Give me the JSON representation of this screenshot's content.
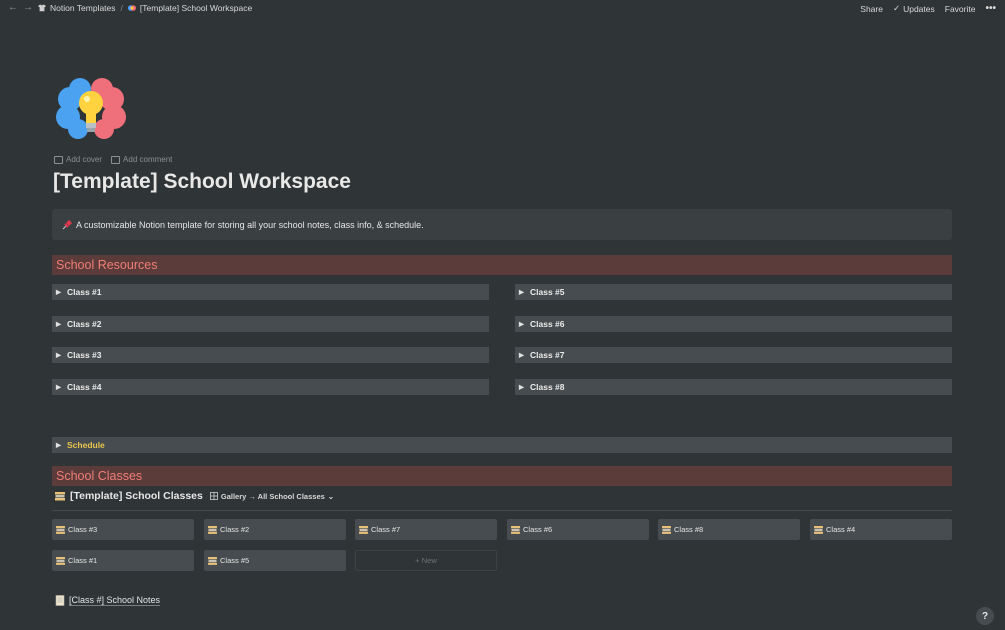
{
  "topbar": {
    "breadcrumb_root": "Notion Templates",
    "breadcrumb_separator": "/",
    "breadcrumb_page": "[Template] School Workspace",
    "share_label": "Share",
    "updates_label": "Updates",
    "favorite_label": "Favorite",
    "more_label": "•••"
  },
  "page": {
    "icon": "brain-lightbulb-icon",
    "add_cover_label": "Add cover",
    "add_comment_label": "Add comment",
    "title": "[Template] School Workspace",
    "callout_icon": "pushpin-icon",
    "callout_text": "A customizable Notion template for storing all your school notes, class info, & schedule."
  },
  "resources": {
    "heading": "School Resources",
    "toggles_left": [
      {
        "label": "Class #1"
      },
      {
        "label": "Class #2"
      },
      {
        "label": "Class #3"
      },
      {
        "label": "Class #4"
      }
    ],
    "toggles_right": [
      {
        "label": "Class #5"
      },
      {
        "label": "Class #6"
      },
      {
        "label": "Class #7"
      },
      {
        "label": "Class #8"
      }
    ],
    "schedule_label": "Schedule"
  },
  "classes": {
    "heading": "School Classes",
    "db_title": "[Template] School Classes",
    "view_label": "Gallery → All School Classes",
    "cards": [
      {
        "label": "Class #3"
      },
      {
        "label": "Class #2"
      },
      {
        "label": "Class #7"
      },
      {
        "label": "Class #6"
      },
      {
        "label": "Class #8"
      },
      {
        "label": "Class #4"
      },
      {
        "label": "Class #1"
      },
      {
        "label": "Class #5"
      }
    ],
    "new_label": "+ New"
  },
  "notes": {
    "link_label": "[Class #] School Notes"
  },
  "help_label": "?",
  "colors": {
    "background": "#2f3437",
    "section_heading_bg": "#5c3b3b",
    "section_heading_text": "#ef7e75",
    "toggle_bg": "#474c50",
    "schedule_text": "#e9c44c"
  }
}
